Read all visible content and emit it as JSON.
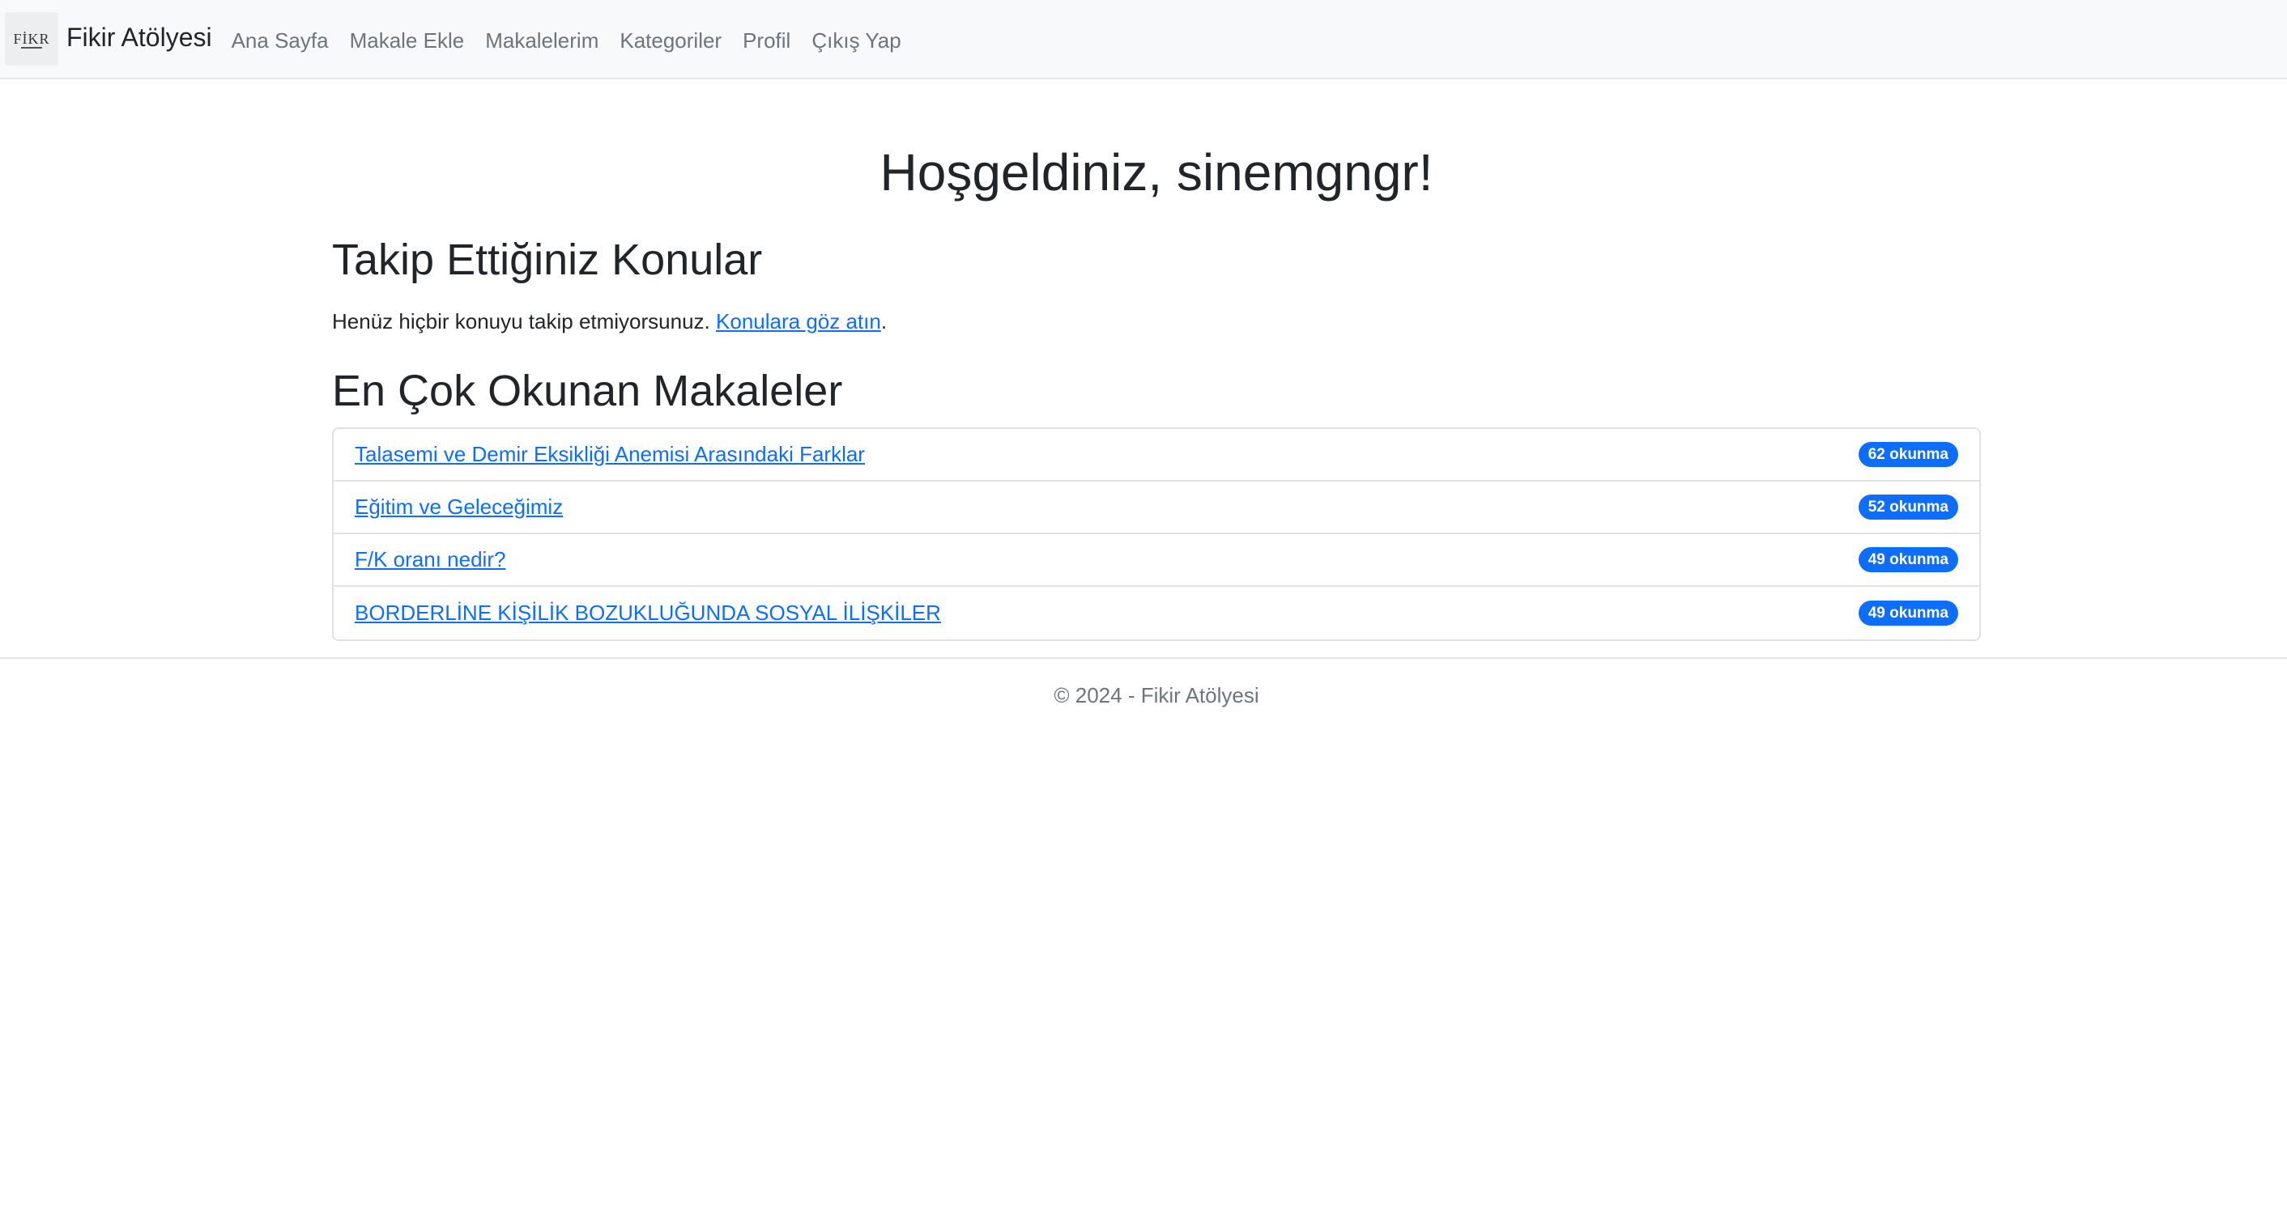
{
  "navbar": {
    "brand_logo_text": "FİKR",
    "brand_name": "Fikir Atölyesi",
    "links": [
      {
        "label": "Ana Sayfa"
      },
      {
        "label": "Makale Ekle"
      },
      {
        "label": "Makalelerim"
      },
      {
        "label": "Kategoriler"
      },
      {
        "label": "Profil"
      },
      {
        "label": "Çıkış Yap"
      }
    ]
  },
  "main": {
    "welcome": "Hoşgeldiniz, sinemgngr!",
    "followed": {
      "title": "Takip Ettiğiniz Konular",
      "empty_text": "Henüz hiçbir konuyu takip etmiyorsunuz.",
      "link_label": "Konulara göz atın",
      "trailing": "."
    },
    "popular": {
      "title": "En Çok Okunan Makaleler",
      "articles": [
        {
          "title": "Talasemi ve Demir Eksikliği Anemisi Arasındaki Farklar",
          "reads": "62 okunma"
        },
        {
          "title": "Eğitim ve Geleceğimiz",
          "reads": "52 okunma"
        },
        {
          "title": "F/K oranı nedir?",
          "reads": "49 okunma"
        },
        {
          "title": "BORDERLİNE KİŞİLİK BOZUKLUĞUNDA SOSYAL İLİŞKİLER",
          "reads": "49 okunma"
        }
      ]
    }
  },
  "footer": {
    "text": "© 2024 - Fikir Atölyesi"
  },
  "colors": {
    "link": "#0d6efd",
    "badge_bg": "#0d6efd",
    "navbar_bg": "#f8f9fa"
  }
}
